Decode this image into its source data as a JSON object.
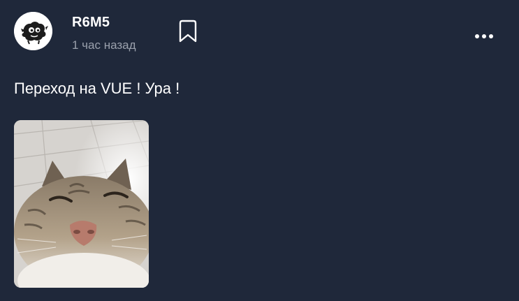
{
  "post": {
    "author": "R6M5",
    "time": "1 час назад",
    "text": "Переход на VUE ! Ура !",
    "avatar_icon": "blob-creature-avatar",
    "bookmark_icon": "bookmark-icon",
    "more_icon": "more-dots-icon",
    "image_subject": "cat-selfie-photo"
  },
  "colors": {
    "background": "#1f283a",
    "text_primary": "#ffffff",
    "text_secondary": "#9aa0ac"
  }
}
